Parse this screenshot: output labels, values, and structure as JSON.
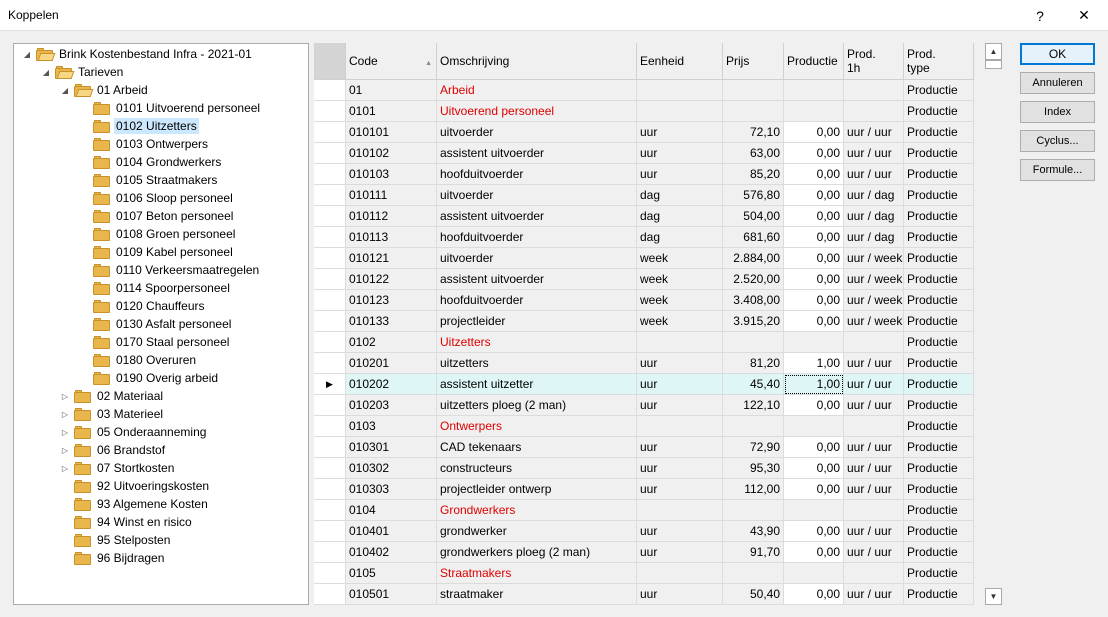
{
  "window": {
    "title": "Koppelen",
    "help": "?",
    "close": "✕"
  },
  "tree": [
    {
      "label": "Brink Kostenbestand Infra - 2021-01",
      "level": 0,
      "exp": "◢",
      "open": true
    },
    {
      "label": "Tarieven",
      "level": 1,
      "exp": "◢",
      "open": true
    },
    {
      "label": "01 Arbeid",
      "level": 2,
      "exp": "◢",
      "open": true
    },
    {
      "label": "0101 Uitvoerend personeel",
      "level": 3,
      "exp": ""
    },
    {
      "label": "0102 Uitzetters",
      "level": 3,
      "exp": "",
      "selected": true
    },
    {
      "label": "0103 Ontwerpers",
      "level": 3,
      "exp": ""
    },
    {
      "label": "0104 Grondwerkers",
      "level": 3,
      "exp": ""
    },
    {
      "label": "0105 Straatmakers",
      "level": 3,
      "exp": ""
    },
    {
      "label": "0106 Sloop personeel",
      "level": 3,
      "exp": ""
    },
    {
      "label": "0107 Beton personeel",
      "level": 3,
      "exp": ""
    },
    {
      "label": "0108 Groen personeel",
      "level": 3,
      "exp": ""
    },
    {
      "label": "0109 Kabel personeel",
      "level": 3,
      "exp": ""
    },
    {
      "label": "0110 Verkeersmaatregelen",
      "level": 3,
      "exp": ""
    },
    {
      "label": "0114 Spoorpersoneel",
      "level": 3,
      "exp": ""
    },
    {
      "label": "0120 Chauffeurs",
      "level": 3,
      "exp": ""
    },
    {
      "label": "0130 Asfalt personeel",
      "level": 3,
      "exp": ""
    },
    {
      "label": "0170 Staal personeel",
      "level": 3,
      "exp": ""
    },
    {
      "label": "0180 Overuren",
      "level": 3,
      "exp": ""
    },
    {
      "label": "0190 Overig arbeid",
      "level": 3,
      "exp": ""
    },
    {
      "label": "02 Materiaal",
      "level": 2,
      "exp": "▷"
    },
    {
      "label": "03 Materieel",
      "level": 2,
      "exp": "▷"
    },
    {
      "label": "05 Onderaanneming",
      "level": 2,
      "exp": "▷"
    },
    {
      "label": "06 Brandstof",
      "level": 2,
      "exp": "▷"
    },
    {
      "label": "07 Stortkosten",
      "level": 2,
      "exp": "▷"
    },
    {
      "label": "92 Uitvoeringskosten",
      "level": 2,
      "exp": ""
    },
    {
      "label": "93 Algemene Kosten",
      "level": 2,
      "exp": ""
    },
    {
      "label": "94 Winst en risico",
      "level": 2,
      "exp": ""
    },
    {
      "label": "95 Stelposten",
      "level": 2,
      "exp": ""
    },
    {
      "label": "96 Bijdragen",
      "level": 2,
      "exp": ""
    }
  ],
  "grid": {
    "headers": [
      "Code",
      "Omschrijving",
      "Eenheid",
      "Prijs",
      "Productie",
      "Prod.\n1h",
      "Prod.\ntype"
    ],
    "sort_arrow": "▲",
    "rows": [
      {
        "code": "01",
        "desc": "Arbeid",
        "unit": "",
        "prijs": "",
        "prod": "",
        "p1h": "",
        "ptype": "Productie",
        "group": true
      },
      {
        "code": "0101",
        "desc": "Uitvoerend personeel",
        "unit": "",
        "prijs": "",
        "prod": "",
        "p1h": "",
        "ptype": "Productie",
        "group": true
      },
      {
        "code": "010101",
        "desc": "uitvoerder",
        "unit": "uur",
        "prijs": "72,10",
        "prod": "0,00",
        "p1h": "uur / uur",
        "ptype": "Productie"
      },
      {
        "code": "010102",
        "desc": "assistent uitvoerder",
        "unit": "uur",
        "prijs": "63,00",
        "prod": "0,00",
        "p1h": "uur / uur",
        "ptype": "Productie"
      },
      {
        "code": "010103",
        "desc": "hoofduitvoerder",
        "unit": "uur",
        "prijs": "85,20",
        "prod": "0,00",
        "p1h": "uur / uur",
        "ptype": "Productie"
      },
      {
        "code": "010111",
        "desc": "uitvoerder",
        "unit": "dag",
        "prijs": "576,80",
        "prod": "0,00",
        "p1h": "uur / dag",
        "ptype": "Productie"
      },
      {
        "code": "010112",
        "desc": "assistent uitvoerder",
        "unit": "dag",
        "prijs": "504,00",
        "prod": "0,00",
        "p1h": "uur / dag",
        "ptype": "Productie"
      },
      {
        "code": "010113",
        "desc": "hoofduitvoerder",
        "unit": "dag",
        "prijs": "681,60",
        "prod": "0,00",
        "p1h": "uur / dag",
        "ptype": "Productie"
      },
      {
        "code": "010121",
        "desc": "uitvoerder",
        "unit": "week",
        "prijs": "2.884,00",
        "prod": "0,00",
        "p1h": "uur / week",
        "ptype": "Productie"
      },
      {
        "code": "010122",
        "desc": "assistent uitvoerder",
        "unit": "week",
        "prijs": "2.520,00",
        "prod": "0,00",
        "p1h": "uur / week",
        "ptype": "Productie"
      },
      {
        "code": "010123",
        "desc": "hoofduitvoerder",
        "unit": "week",
        "prijs": "3.408,00",
        "prod": "0,00",
        "p1h": "uur / week",
        "ptype": "Productie"
      },
      {
        "code": "010133",
        "desc": "projectleider",
        "unit": "week",
        "prijs": "3.915,20",
        "prod": "0,00",
        "p1h": "uur / week",
        "ptype": "Productie"
      },
      {
        "code": "0102",
        "desc": "Uitzetters",
        "unit": "",
        "prijs": "",
        "prod": "",
        "p1h": "",
        "ptype": "Productie",
        "group": true
      },
      {
        "code": "010201",
        "desc": "uitzetters",
        "unit": "uur",
        "prijs": "81,20",
        "prod": "1,00",
        "p1h": "uur / uur",
        "ptype": "Productie"
      },
      {
        "code": "010202",
        "desc": "assistent uitzetter",
        "unit": "uur",
        "prijs": "45,40",
        "prod": "1,00",
        "p1h": "uur / uur",
        "ptype": "Productie",
        "current": true
      },
      {
        "code": "010203",
        "desc": "uitzetters ploeg (2 man)",
        "unit": "uur",
        "prijs": "122,10",
        "prod": "0,00",
        "p1h": "uur / uur",
        "ptype": "Productie"
      },
      {
        "code": "0103",
        "desc": "Ontwerpers",
        "unit": "",
        "prijs": "",
        "prod": "",
        "p1h": "",
        "ptype": "Productie",
        "group": true
      },
      {
        "code": "010301",
        "desc": "CAD tekenaars",
        "unit": "uur",
        "prijs": "72,90",
        "prod": "0,00",
        "p1h": "uur / uur",
        "ptype": "Productie"
      },
      {
        "code": "010302",
        "desc": "constructeurs",
        "unit": "uur",
        "prijs": "95,30",
        "prod": "0,00",
        "p1h": "uur / uur",
        "ptype": "Productie"
      },
      {
        "code": "010303",
        "desc": "projectleider ontwerp",
        "unit": "uur",
        "prijs": "112,00",
        "prod": "0,00",
        "p1h": "uur / uur",
        "ptype": "Productie"
      },
      {
        "code": "0104",
        "desc": "Grondwerkers",
        "unit": "",
        "prijs": "",
        "prod": "",
        "p1h": "",
        "ptype": "Productie",
        "group": true
      },
      {
        "code": "010401",
        "desc": "grondwerker",
        "unit": "uur",
        "prijs": "43,90",
        "prod": "0,00",
        "p1h": "uur / uur",
        "ptype": "Productie"
      },
      {
        "code": "010402",
        "desc": "grondwerkers ploeg (2 man)",
        "unit": "uur",
        "prijs": "91,70",
        "prod": "0,00",
        "p1h": "uur / uur",
        "ptype": "Productie"
      },
      {
        "code": "0105",
        "desc": "Straatmakers",
        "unit": "",
        "prijs": "",
        "prod": "",
        "p1h": "",
        "ptype": "Productie",
        "group": true
      },
      {
        "code": "010501",
        "desc": "straatmaker",
        "unit": "uur",
        "prijs": "50,40",
        "prod": "0,00",
        "p1h": "uur / uur",
        "ptype": "Productie"
      }
    ]
  },
  "buttons": [
    {
      "label": "OK",
      "name": "ok-button",
      "default": true
    },
    {
      "label": "Annuleren",
      "name": "annuleren-button"
    },
    {
      "label": "Index",
      "name": "index-button"
    },
    {
      "label": "Cyclus...",
      "name": "cyclus-button"
    },
    {
      "label": "Formule...",
      "name": "formule-button"
    }
  ],
  "scroll": {
    "up": "▲",
    "down": "▼"
  }
}
